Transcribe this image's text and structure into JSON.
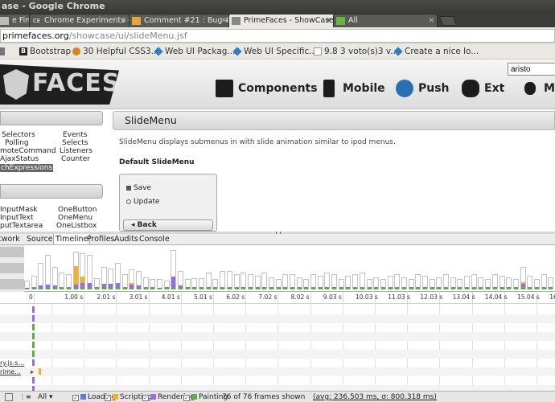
{
  "window": {
    "title": "ase - Google Chrome"
  },
  "tabs": [
    {
      "label": "e Fin",
      "fav": ""
    },
    {
      "label": "Chrome Experiments - Ho",
      "fav": "CE"
    },
    {
      "label": "Comment #21 : Bug #111",
      "fav": ""
    },
    {
      "label": "PrimeFaces - ShowCase",
      "fav": ""
    },
    {
      "label": "All",
      "fav": ""
    }
  ],
  "omnibox": {
    "host": "primefaces.org",
    "path": "/showcase/ui/slideMenu.jsf"
  },
  "bookmarks": [
    {
      "label": "",
      "icon_color": "#777777"
    },
    {
      "label": "Bootstrap",
      "icon_color": "#222222"
    },
    {
      "label": "30 Helpful CSS3...",
      "icon_color": "#d9822b"
    },
    {
      "label": "Web UI Packag...",
      "icon_color": "#2d7fbf"
    },
    {
      "label": "Web UI Specific...",
      "icon_color": "#2d7fbf"
    },
    {
      "label": "9.8 3 voto(s)3 v...",
      "icon_color": "#dddddd"
    },
    {
      "label": "Create a nice lo...",
      "icon_color": "#2d7fbf"
    }
  ],
  "site": {
    "logo_text": "FACES",
    "search_value": "aristo",
    "nav": [
      {
        "label": "Components",
        "icon": "components-icon"
      },
      {
        "label": "Mobile",
        "icon": "mobile-icon"
      },
      {
        "label": "Push",
        "icon": "push-icon"
      },
      {
        "label": "Ext",
        "icon": "ext-icon"
      },
      {
        "label": "Mo",
        "icon": "apple-icon"
      }
    ]
  },
  "sidebar": {
    "group1": {
      "left": [
        "Selectors",
        "Polling",
        "moteCommand",
        "AjaxStatus",
        "chExpressions"
      ],
      "right": [
        "Events",
        "Selects",
        "Listeners",
        "Counter"
      ],
      "selected": "chExpressions"
    },
    "group2": {
      "left": [
        "InputMask",
        "InputText",
        "putTextarea"
      ],
      "right": [
        "OneButton",
        "OneMenu",
        "OneListbox"
      ]
    }
  },
  "content": {
    "title": "SlideMenu",
    "description": "SlideMenu displays submenus in with slide animation similar to ipod menus.",
    "heading": "Default SlideMenu",
    "menu_items": [
      "Save",
      "Update"
    ],
    "back_label": "Back"
  },
  "devtools": {
    "tabs": [
      "twork",
      "Sources",
      "Timeline",
      "Profiles",
      "Audits",
      "Console"
    ],
    "active_tab": "Timeline",
    "ruler_labels": [
      "0",
      "1.00 s",
      "2.01 s",
      "3.01 s",
      "4.01 s",
      "5.01 s",
      "6.02 s",
      "7.02 s",
      "8.02 s",
      "9.03 s",
      "10.03 s",
      "11.03 s",
      "12.03 s",
      "13.04 s",
      "14.04 s",
      "15.04 s",
      "16.05"
    ],
    "record_labels": [
      "",
      "",
      "",
      "",
      "",
      "",
      "ry.js:s...",
      "rime...",
      "",
      ""
    ],
    "status": {
      "filter": "All",
      "categories": [
        {
          "label": "Loading",
          "color": "#5c7fd1",
          "checked": true
        },
        {
          "label": "Scripting",
          "color": "#f0b030",
          "checked": true
        },
        {
          "label": "Rendering",
          "color": "#9b6be0",
          "checked": true
        },
        {
          "label": "Painting",
          "color": "#5fa94e",
          "checked": true
        }
      ],
      "frames_text": "76 of 76 frames shown",
      "avg_text": "(avg: 236.503 ms, σ: 800.318 ms)"
    }
  },
  "chart_data": {
    "type": "bar",
    "frames": [
      {
        "s": 0,
        "r": 0,
        "p": 2
      },
      {
        "s": 0,
        "r": 0,
        "p": 3
      },
      {
        "s": 0,
        "r": 3,
        "p": 2
      },
      {
        "s": 0,
        "r": 4,
        "p": 2
      },
      {
        "s": 0,
        "r": 2,
        "p": 3
      },
      {
        "s": 0,
        "r": 0,
        "p": 3
      },
      {
        "s": 0,
        "r": 0,
        "p": 3
      },
      {
        "s": 25,
        "r": 4,
        "p": 2
      },
      {
        "s": 8,
        "r": 6,
        "p": 3
      },
      {
        "s": 0,
        "r": 6,
        "p": 3
      },
      {
        "s": 0,
        "r": 0,
        "p": 3
      },
      {
        "s": 0,
        "r": 4,
        "p": 3
      },
      {
        "s": 0,
        "r": 4,
        "p": 3
      },
      {
        "s": 0,
        "r": 5,
        "p": 3
      },
      {
        "s": 0,
        "r": 0,
        "p": 3
      },
      {
        "s": 2,
        "r": 4,
        "p": 2
      },
      {
        "s": 0,
        "r": 3,
        "p": 2
      },
      {
        "s": 0,
        "r": 0,
        "p": 3
      },
      {
        "s": 0,
        "r": 0,
        "p": 3
      },
      {
        "s": 0,
        "r": 0,
        "p": 2
      },
      {
        "s": 0,
        "r": 0,
        "p": 3
      },
      {
        "s": 0,
        "r": 14,
        "p": 3
      },
      {
        "s": 0,
        "r": 3,
        "p": 2
      },
      {
        "s": 0,
        "r": 0,
        "p": 3
      },
      {
        "s": 0,
        "r": 0,
        "p": 3
      },
      {
        "s": 0,
        "r": 0,
        "p": 3
      },
      {
        "s": 0,
        "r": 0,
        "p": 3
      },
      {
        "s": 0,
        "r": 0,
        "p": 3
      },
      {
        "s": 0,
        "r": 0,
        "p": 3
      },
      {
        "s": 0,
        "r": 0,
        "p": 3
      },
      {
        "s": 0,
        "r": 0,
        "p": 3
      },
      {
        "s": 0,
        "r": 0,
        "p": 3
      },
      {
        "s": 0,
        "r": 0,
        "p": 3
      },
      {
        "s": 0,
        "r": 0,
        "p": 3
      },
      {
        "s": 0,
        "r": 0,
        "p": 3
      },
      {
        "s": 0,
        "r": 0,
        "p": 3
      },
      {
        "s": 0,
        "r": 0,
        "p": 3
      },
      {
        "s": 0,
        "r": 0,
        "p": 3
      },
      {
        "s": 0,
        "r": 0,
        "p": 3
      },
      {
        "s": 0,
        "r": 0,
        "p": 3
      },
      {
        "s": 0,
        "r": 0,
        "p": 3
      },
      {
        "s": 0,
        "r": 0,
        "p": 3
      },
      {
        "s": 0,
        "r": 0,
        "p": 3
      },
      {
        "s": 0,
        "r": 0,
        "p": 3
      },
      {
        "s": 0,
        "r": 0,
        "p": 3
      },
      {
        "s": 0,
        "r": 0,
        "p": 3
      },
      {
        "s": 0,
        "r": 0,
        "p": 3
      },
      {
        "s": 0,
        "r": 0,
        "p": 3
      },
      {
        "s": 0,
        "r": 0,
        "p": 3
      },
      {
        "s": 0,
        "r": 0,
        "p": 3
      },
      {
        "s": 0,
        "r": 0,
        "p": 3
      },
      {
        "s": 0,
        "r": 0,
        "p": 3
      },
      {
        "s": 0,
        "r": 0,
        "p": 3
      },
      {
        "s": 0,
        "r": 0,
        "p": 3
      },
      {
        "s": 0,
        "r": 0,
        "p": 3
      },
      {
        "s": 0,
        "r": 0,
        "p": 3
      },
      {
        "s": 0,
        "r": 0,
        "p": 3
      },
      {
        "s": 0,
        "r": 0,
        "p": 3
      },
      {
        "s": 0,
        "r": 0,
        "p": 3
      },
      {
        "s": 0,
        "r": 0,
        "p": 3
      },
      {
        "s": 0,
        "r": 0,
        "p": 3
      },
      {
        "s": 0,
        "r": 0,
        "p": 3
      },
      {
        "s": 0,
        "r": 0,
        "p": 3
      },
      {
        "s": 0,
        "r": 0,
        "p": 3
      },
      {
        "s": 0,
        "r": 0,
        "p": 3
      },
      {
        "s": 0,
        "r": 0,
        "p": 3
      },
      {
        "s": 0,
        "r": 0,
        "p": 3
      },
      {
        "s": 0,
        "r": 0,
        "p": 3
      },
      {
        "s": 0,
        "r": 0,
        "p": 3
      },
      {
        "s": 0,
        "r": 0,
        "p": 3
      },
      {
        "s": 0,
        "r": 0,
        "p": 3
      },
      {
        "s": 3,
        "r": 4,
        "p": 3
      },
      {
        "s": 0,
        "r": 0,
        "p": 3
      },
      {
        "s": 0,
        "r": 0,
        "p": 3
      },
      {
        "s": 0,
        "r": 0,
        "p": 3
      },
      {
        "s": 0,
        "r": 0,
        "p": 3
      }
    ],
    "frame_totals": [
      12,
      18,
      35,
      45,
      30,
      22,
      20,
      50,
      48,
      46,
      15,
      30,
      28,
      35,
      20,
      26,
      24,
      16,
      14,
      14,
      12,
      52,
      24,
      14,
      15,
      15,
      22,
      14,
      24,
      24,
      20,
      22,
      20,
      18,
      22,
      16,
      14,
      20,
      20,
      16,
      14,
      20,
      18,
      22,
      20,
      14,
      18,
      20,
      22,
      14,
      16,
      14,
      18,
      20,
      16,
      14,
      20,
      18,
      14,
      16,
      20,
      16,
      14,
      18,
      20,
      16,
      14,
      20,
      18,
      16,
      14,
      30,
      18,
      14,
      20,
      16
    ],
    "colors": {
      "scripting": "#f0b030",
      "rendering": "#9b6be0",
      "painting": "#5fa94e"
    },
    "ylim": [
      0,
      55
    ]
  }
}
